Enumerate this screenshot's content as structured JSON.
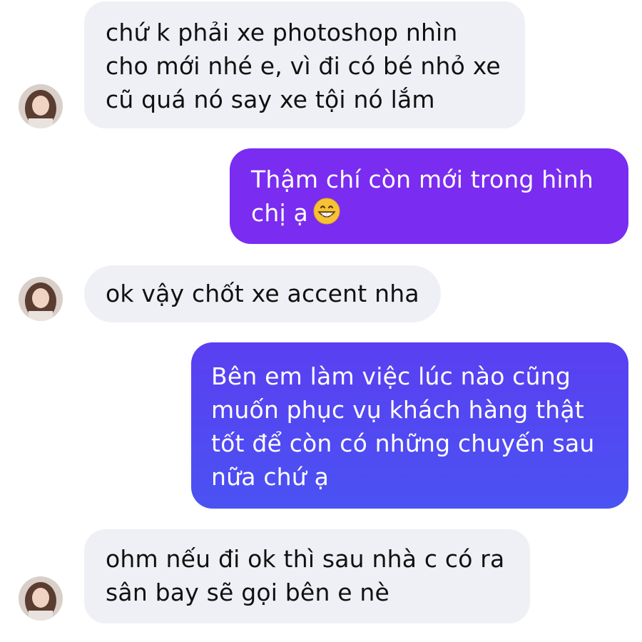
{
  "conversation": {
    "messages": [
      {
        "direction": "incoming",
        "lines": [
          "chứ k phải xe photoshop nhìn",
          "cho mới nhé e, vì đi có bé nhỏ xe",
          "cũ quá nó say xe tội nó lắm"
        ]
      },
      {
        "direction": "outgoing",
        "lines": [
          "Thậm chí còn mới trong hình",
          "chị ạ"
        ],
        "emoji": "grinning-face-with-smiling-eyes"
      },
      {
        "direction": "incoming",
        "lines": [
          "ok vậy chốt xe accent nha"
        ]
      },
      {
        "direction": "outgoing",
        "lines": [
          "Bên em làm việc lúc nào cũng",
          "muốn phục vụ khách hàng thật",
          "tốt để còn có những chuyến sau",
          "nữa chứ ạ"
        ]
      },
      {
        "direction": "incoming",
        "lines": [
          "ohm nếu đi ok thì sau nhà c có ra",
          "sân bay sẽ gọi bên e nè"
        ]
      }
    ]
  },
  "colors": {
    "incoming_bubble": "#eff0f5",
    "outgoing_top": "#7a2cf0",
    "outgoing_bottom": "#4a52f2",
    "emoji_face": "#f7c234"
  }
}
